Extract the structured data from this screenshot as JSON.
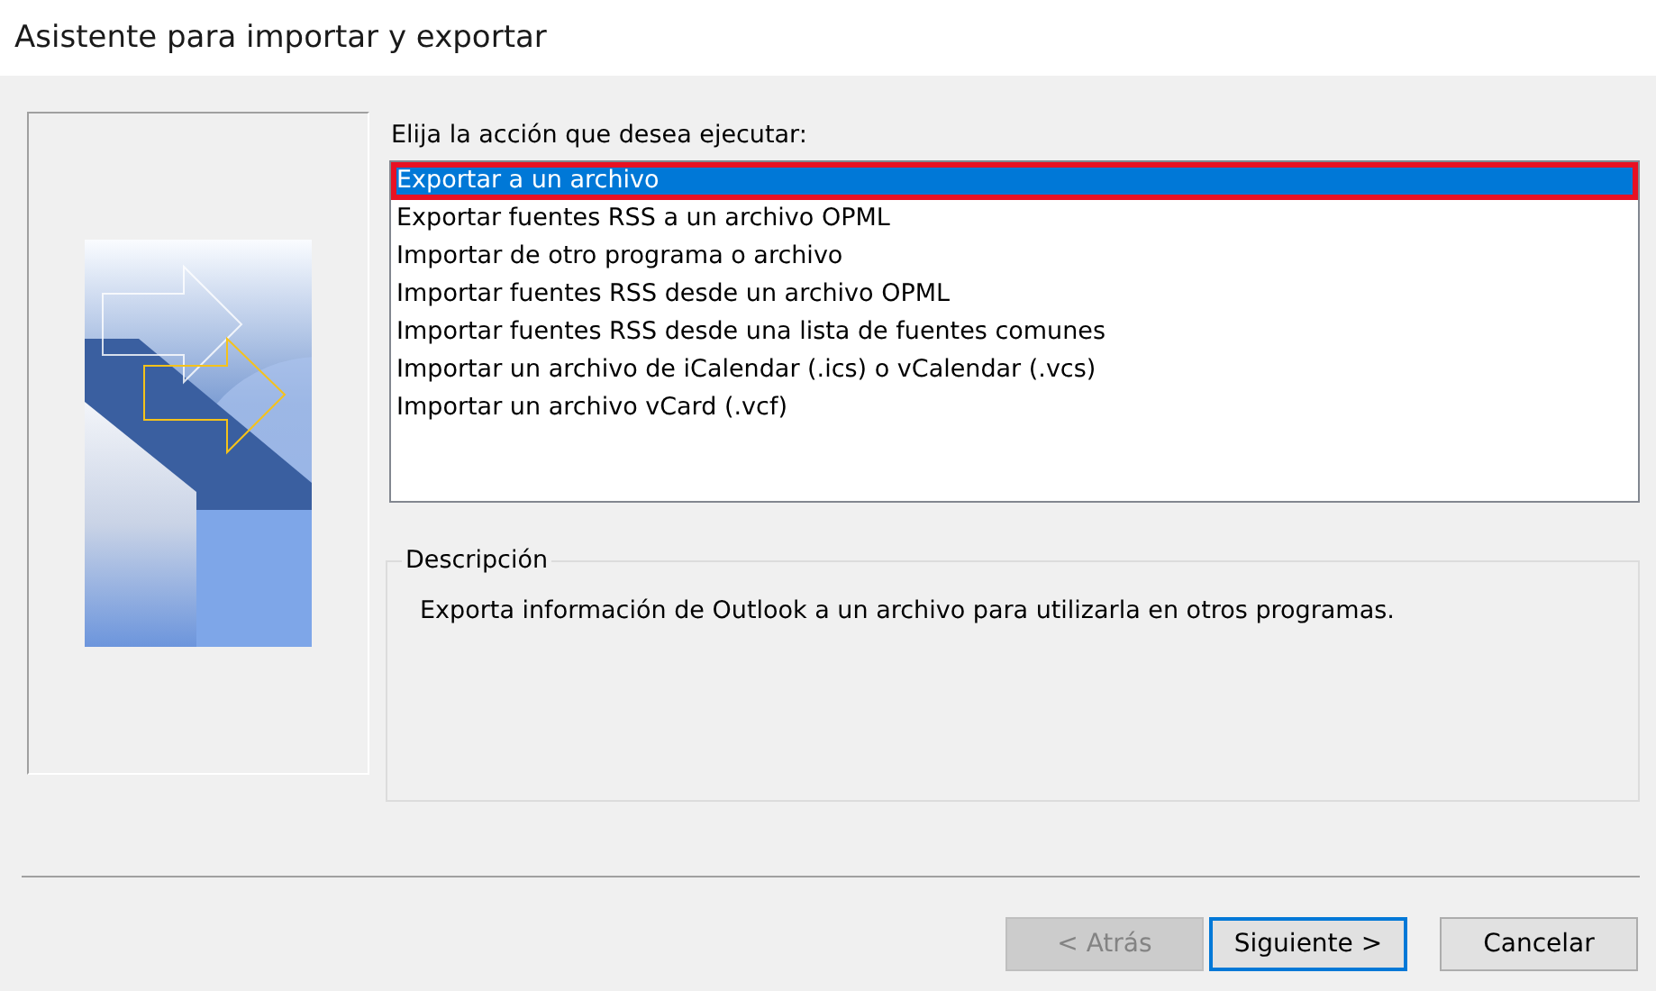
{
  "window": {
    "title": "Asistente para importar y exportar"
  },
  "action_list": {
    "label": "Elija la acción que desea ejecutar:",
    "items": [
      {
        "label": "Exportar a un archivo",
        "selected": true,
        "annotated": true
      },
      {
        "label": "Exportar fuentes RSS a un archivo OPML",
        "selected": false,
        "annotated": false
      },
      {
        "label": "Importar de otro programa o archivo",
        "selected": false,
        "annotated": false
      },
      {
        "label": "Importar fuentes RSS desde un archivo OPML",
        "selected": false,
        "annotated": false
      },
      {
        "label": "Importar fuentes RSS desde una lista de fuentes comunes",
        "selected": false,
        "annotated": false
      },
      {
        "label": "Importar un archivo de iCalendar (.ics) o vCalendar (.vcs)",
        "selected": false,
        "annotated": false
      },
      {
        "label": "Importar un archivo vCard (.vcf)",
        "selected": false,
        "annotated": false
      }
    ]
  },
  "description": {
    "title": "Descripción",
    "text": "Exporta información de Outlook a un archivo para utilizarla en otros programas."
  },
  "buttons": [
    {
      "label": "< Atrás",
      "disabled": true,
      "default": false
    },
    {
      "label": "Siguiente >",
      "disabled": false,
      "default": true
    },
    {
      "label": "Cancelar",
      "disabled": false,
      "default": false
    }
  ]
}
